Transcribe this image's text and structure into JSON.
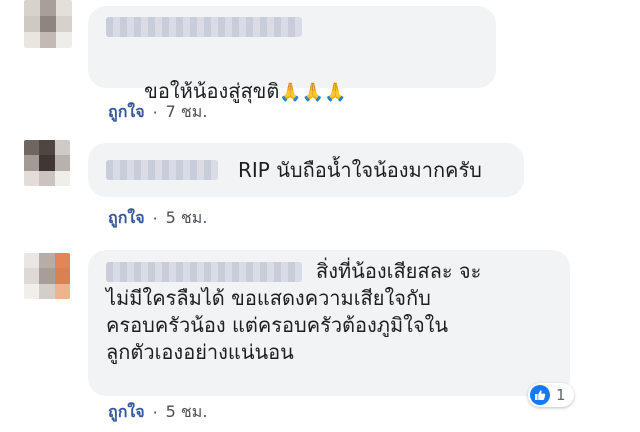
{
  "comments": [
    {
      "text": "ขอให้น้องสู่สุขติ",
      "emoji": "🙏🙏🙏",
      "like_label": "ถูกใจ",
      "time": "7 ชม."
    },
    {
      "text": "RIP นับถือน้ำใจน้องมากครับ",
      "like_label": "ถูกใจ",
      "time": "5 ชม."
    },
    {
      "text_line1": "สิ่งที่น้องเสียสละ จะ",
      "text_rest": "ไม่มีใครลืมได้ ขอแสดงความเสียใจกับ\nครอบครัวน้อง แต่ครอบครัวต้องภูมิใจใน\nลูกตัวเองอย่างแน่นอน",
      "like_label": "ถูกใจ",
      "time": "5 ชม.",
      "reaction_count": "1"
    }
  ],
  "icons": {
    "like_reaction": "like-thumb-icon",
    "like_color": "#1877f2",
    "link_color": "#365899",
    "bubble_color": "#f2f3f5"
  }
}
